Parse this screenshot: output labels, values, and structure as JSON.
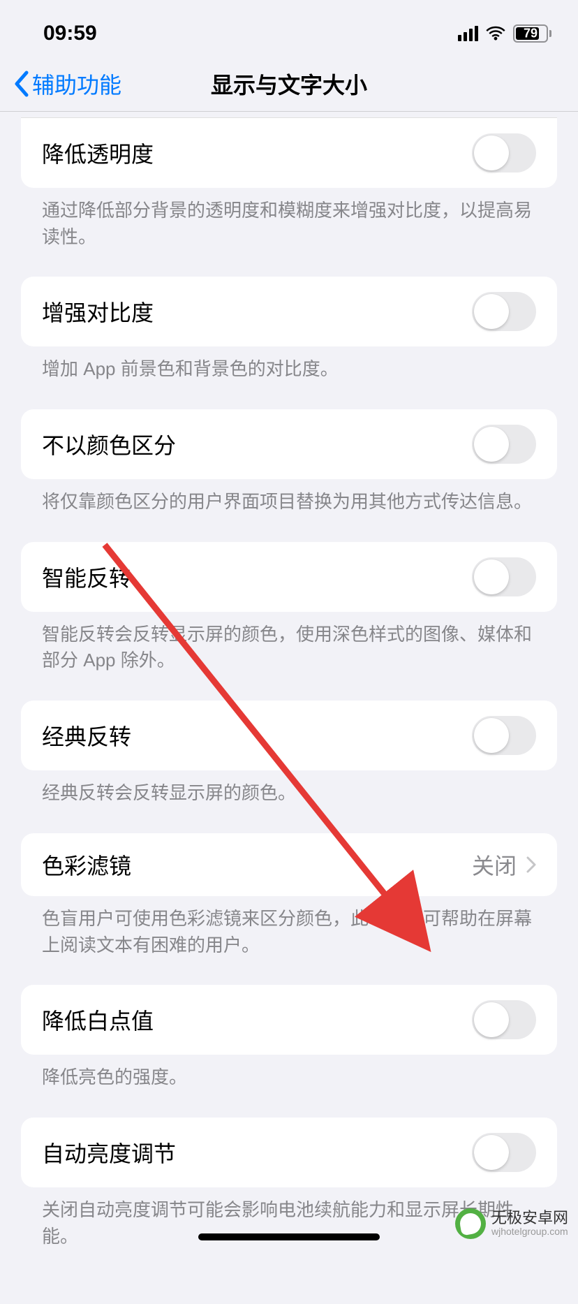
{
  "status_bar": {
    "time": "09:59",
    "battery_percent": "79"
  },
  "nav": {
    "back_label": "辅助功能",
    "title": "显示与文字大小"
  },
  "groups": [
    {
      "label": "降低透明度",
      "footer": "通过降低部分背景的透明度和模糊度来增强对比度，以提高易读性。",
      "type": "toggle",
      "partial_top": true
    },
    {
      "label": "增强对比度",
      "footer": "增加 App 前景色和背景色的对比度。",
      "type": "toggle"
    },
    {
      "label": "不以颜色区分",
      "footer": "将仅靠颜色区分的用户界面项目替换为用其他方式传达信息。",
      "type": "toggle"
    },
    {
      "label": "智能反转",
      "footer": "智能反转会反转显示屏的颜色，使用深色样式的图像、媒体和部分 App 除外。",
      "type": "toggle"
    },
    {
      "label": "经典反转",
      "footer": "经典反转会反转显示屏的颜色。",
      "type": "toggle"
    },
    {
      "label": "色彩滤镜",
      "value": "关闭",
      "footer": "色盲用户可使用色彩滤镜来区分颜色，此功能还可帮助在屏幕上阅读文本有困难的用户。",
      "type": "nav"
    },
    {
      "label": "降低白点值",
      "footer": "降低亮色的强度。",
      "type": "toggle"
    },
    {
      "label": "自动亮度调节",
      "footer": "关闭自动亮度调节可能会影响电池续航能力和显示屏长期性能。",
      "type": "toggle"
    }
  ],
  "watermark": {
    "cn": "无极安卓网",
    "en": "wjhotelgroup.com"
  }
}
